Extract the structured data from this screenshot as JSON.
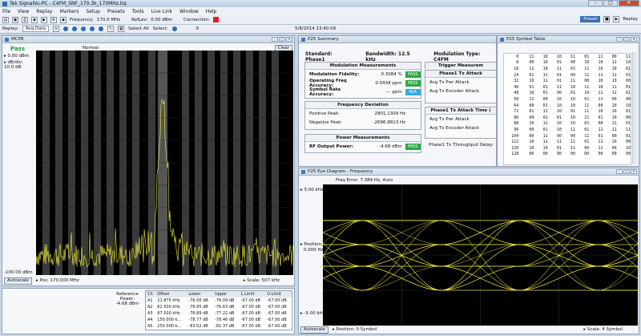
{
  "app": {
    "title": "Tek SignalVu-PC - C4FM_SNF_170.3k_170MHz.tiq",
    "window_buttons": [
      "–",
      "□",
      "✕"
    ]
  },
  "menu": [
    "File",
    "View",
    "Replay",
    "Markers",
    "Setup",
    "Presets",
    "Tools",
    "Live Link",
    "Window",
    "Help"
  ],
  "toolbar": {
    "frequency_label": "Frequency:",
    "frequency_value": "170.0 MHz",
    "reflev_label": "RefLev:",
    "reflev_value": "0.00 dBm",
    "connection_label": "Connection:",
    "preset_label": "Preset",
    "replay_label": "Replay",
    "status_color": "#d22222"
  },
  "toolbar2": {
    "replay_label": "Replay:",
    "replay_select": "Acq Data",
    "select_all_label": "Select All",
    "select_label": "Select:",
    "counter": "9",
    "timestamp": "5/8/2014 13:40:09"
  },
  "mcpr": {
    "title": "MCPR",
    "status": "Pass",
    "ref_level": "0.00 dBm",
    "dbdiv_label": "dB/div:",
    "dbdiv_value": "10.0 dB",
    "mode": "Normal",
    "clear_label": "Clear",
    "bottom_level": "-100.00 dBm",
    "autoscale_label": "Autoscale",
    "position_label": "Pos: 170.000 MHz",
    "scale_label": "Scale: 507 kHz"
  },
  "results": {
    "reference_label": "Reference Power:",
    "reference_value": "-4.68 dBm",
    "headers": [
      "Ch",
      "Offset",
      "Lower",
      "Upper",
      "L.Limit",
      "U.Limit"
    ],
    "rows": [
      [
        "A1",
        "21.875 kHz",
        "-76.06 dB",
        "-76.09 dB",
        "-67.00 dB",
        "-67.00 dB"
      ],
      [
        "A2",
        "62.500 kHz",
        "-76.95 dB",
        "-76.63 dB",
        "-67.00 dB",
        "-67.00 dB"
      ],
      [
        "A3",
        "87.500 kHz",
        "-76.89 dB",
        "-77.22 dB",
        "-67.00 dB",
        "-67.00 dB"
      ],
      [
        "A4",
        "150.000 k...",
        "-78.77 dB",
        "-78.46 dB",
        "-67.00 dB",
        "-67.00 dB"
      ],
      [
        "A5",
        "250.000 k...",
        "-83.02 dB",
        "-82.37 dB",
        "-67.00 dB",
        "-67.00 dB"
      ]
    ]
  },
  "summary": {
    "title": "P25 Summary",
    "standard": "Standard: Phase1",
    "bandwidth": "Bandwidth: 12.5 kHz",
    "modulation_type": "Modulation Type: C4FM",
    "mod_header": "Modulation Measurements",
    "mod_rows": [
      {
        "label": "Modulation Fidelity:",
        "value": "0.3084 %",
        "badge": "PASS"
      },
      {
        "label": "Operating Freq Accuracy:",
        "value": "0.0434 ppm",
        "badge": "PASS"
      },
      {
        "label": "Symbol Rate Accuracy:",
        "value": "--- ppm",
        "badge": "N/A"
      }
    ],
    "freqdev_header": "Frequency Deviation",
    "freqdev_rows": [
      {
        "label": "Positive Peak:",
        "value": "2801.1309 Hz"
      },
      {
        "label": "Negative Peak:",
        "value": "-2696.8813 Hz"
      }
    ],
    "power_header": "Power Measurements",
    "power_row": {
      "label": "RF Output Power:",
      "value": "-4.68 dBm",
      "badge": "PASS"
    },
    "trigger_header": "Trigger Measurem",
    "attack_header": "Phase1 Tx Attack",
    "attack_rows": [
      "Avg Tx Pwr Attack",
      "Avg Tx Encoder Attack"
    ],
    "attack_time_header": "Phase1 Tx Attack Time (",
    "attack_time_rows": [
      "Avg Tx Pwr Attack",
      "Avg Tx Encoder Attack"
    ],
    "throughput": "Phase1 Tx Throughput Delay:"
  },
  "symtable": {
    "title": "P25 Symbol Table",
    "rows": [
      [
        "0",
        "11",
        "10",
        "10",
        "11",
        "01",
        "11",
        "00",
        "11"
      ],
      [
        "8",
        "00",
        "10",
        "01",
        "00",
        "10",
        "10",
        "11",
        "10"
      ],
      [
        "16",
        "11",
        "10",
        "11",
        "01",
        "11",
        "10",
        "10",
        "01"
      ],
      [
        "24",
        "01",
        "11",
        "01",
        "00",
        "11",
        "11",
        "11",
        "01"
      ],
      [
        "32",
        "10",
        "11",
        "01",
        "11",
        "00",
        "10",
        "10",
        "00"
      ],
      [
        "40",
        "01",
        "01",
        "11",
        "10",
        "11",
        "10",
        "11",
        "01"
      ],
      [
        "48",
        "10",
        "01",
        "00",
        "01",
        "10",
        "11",
        "11",
        "01"
      ],
      [
        "56",
        "11",
        "00",
        "10",
        "10",
        "01",
        "11",
        "00",
        "00"
      ],
      [
        "64",
        "00",
        "01",
        "10",
        "10",
        "11",
        "00",
        "10",
        "10"
      ],
      [
        "72",
        "01",
        "11",
        "10",
        "01",
        "11",
        "10",
        "10",
        "01"
      ],
      [
        "80",
        "00",
        "01",
        "01",
        "10",
        "11",
        "01",
        "10",
        "00"
      ],
      [
        "88",
        "10",
        "11",
        "10",
        "10",
        "01",
        "00",
        "11",
        "01"
      ],
      [
        "96",
        "00",
        "01",
        "10",
        "11",
        "01",
        "11",
        "11",
        "11"
      ],
      [
        "104",
        "00",
        "11",
        "00",
        "00",
        "11",
        "01",
        "00",
        "01"
      ],
      [
        "112",
        "10",
        "11",
        "11",
        "11",
        "01",
        "11",
        "10",
        "00"
      ],
      [
        "120",
        "10",
        "10",
        "01",
        "11",
        "00",
        "11",
        "00",
        "10"
      ],
      [
        "128",
        "00",
        "00",
        "00",
        "00",
        "00",
        "00",
        "00",
        "00"
      ]
    ]
  },
  "eye": {
    "title": "P25 Eye Diagram - Frequency",
    "freq_error": "Freq Error: 7.384 Hz, Auto",
    "top_label": "5.00 kHz",
    "position_label": "Position:",
    "position_value": "0.000 Hz",
    "bottom_label": "-5.00 kHz",
    "autoscale_label": "Autoscale",
    "pos_symbol": "Position: 0 Symbol",
    "scale_symbol": "Scale: 4 Symbol"
  },
  "colors": {
    "trace": "#f2f03c",
    "plot_bg": "#000000",
    "pass": "#2aa845",
    "na": "#39a9e0",
    "accent": "#3d6fb3"
  }
}
